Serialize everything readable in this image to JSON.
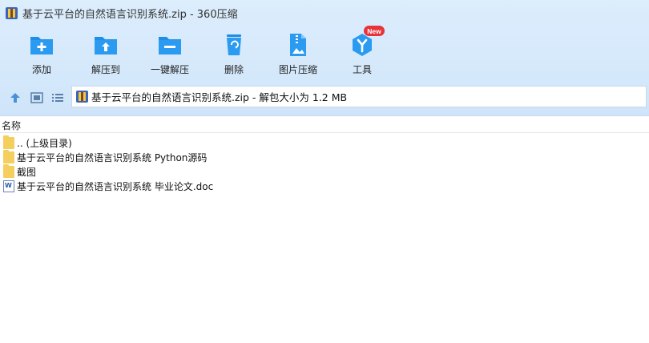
{
  "window": {
    "title": "基于云平台的自然语言识别系统.zip - 360压缩"
  },
  "toolbar": {
    "buttons": [
      {
        "label": "添加"
      },
      {
        "label": "解压到"
      },
      {
        "label": "一键解压"
      },
      {
        "label": "删除"
      },
      {
        "label": "图片压缩"
      },
      {
        "label": "工具",
        "badge": "New"
      }
    ]
  },
  "addressbar": {
    "path": "基于云平台的自然语言识别系统.zip - 解包大小为 1.2 MB"
  },
  "list": {
    "column_name": "名称",
    "rows": [
      {
        "name": ".. (上级目录)",
        "type": "folder"
      },
      {
        "name": "基于云平台的自然语言识别系统 Python源码",
        "type": "folder"
      },
      {
        "name": "截图",
        "type": "folder"
      },
      {
        "name": "基于云平台的自然语言识别系统 毕业论文.doc",
        "type": "doc"
      }
    ]
  },
  "colors": {
    "accent": "#1e8ee6",
    "toolbar_bg": "#d6e9fb",
    "badge": "#e8333a"
  }
}
